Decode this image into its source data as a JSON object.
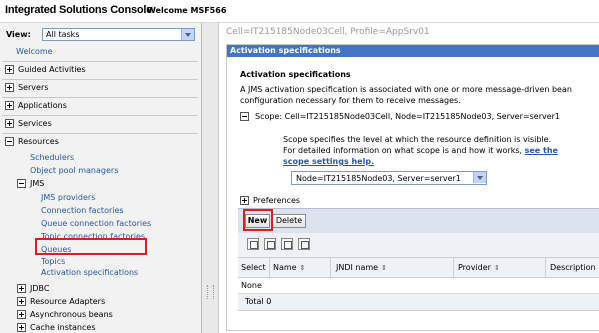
{
  "header": {
    "app_title": "Integrated Solutions Console",
    "welcome": "Welcome MSF566"
  },
  "sidebar": {
    "view_label": "View:",
    "view_value": "All tasks",
    "welcome_link": "Welcome",
    "sections": [
      {
        "label": "Guided Activities",
        "expanded": false
      },
      {
        "label": "Servers",
        "expanded": false
      },
      {
        "label": "Applications",
        "expanded": false
      },
      {
        "label": "Services",
        "expanded": false
      },
      {
        "label": "Resources",
        "expanded": true
      }
    ],
    "resources_children": [
      "Schedulers",
      "Object pool managers"
    ],
    "jms_label": "JMS",
    "jms_children": [
      "JMS providers",
      "Connection factories",
      "Queue connection factories",
      "Topic connection factories",
      "Queues",
      "Topics",
      "Activation specifications"
    ],
    "more_sections": [
      "JDBC",
      "Resource Adapters",
      "Asynchronous beans",
      "Cache instances"
    ]
  },
  "breadcrumb": "Cell=IT215185Node03Cell, Profile=AppSrv01",
  "panel": {
    "header": "Activation specifications",
    "title": "Activation specifications",
    "description_1": "A JMS activation specification is associated with one or more message-driven bean",
    "description_2": "configuration necessary for them to receive messages.",
    "scope_line": "Scope: Cell=IT215185Node03Cell, Node=IT215185Node03, Server=server1",
    "scope_desc_1": "Scope specifies the level at which the resource definition is visible.",
    "scope_desc_2": "For detailed information on what scope is and how it works,",
    "scope_link_1": "see the",
    "scope_link_2": "scope settings help.",
    "scope_select": "Node=IT215185Node03, Server=server1",
    "preferences": "Preferences"
  },
  "toolbar": {
    "new_label": "New",
    "delete_label": "Delete"
  },
  "table": {
    "columns": [
      "Select",
      "Name",
      "JNDI name",
      "Provider",
      "Description"
    ],
    "empty": "None",
    "total": "Total 0"
  },
  "colors": {
    "panel_header": "#4275c4",
    "link": "#2b56a6",
    "highlight": "#d82020"
  }
}
